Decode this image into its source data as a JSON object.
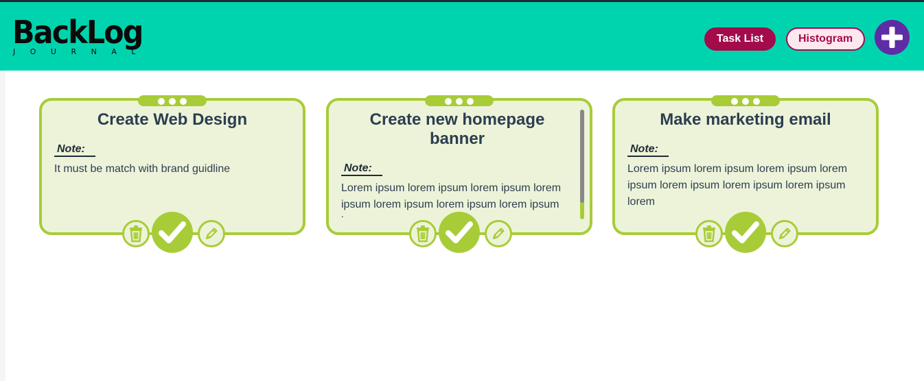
{
  "app": {
    "logo_title": "BackLog",
    "logo_subtitle": "JOURNAL"
  },
  "header": {
    "task_list_label": "Task List",
    "histogram_label": "Histogram",
    "add_icon": "plus-icon"
  },
  "colors": {
    "header_bg": "#00d4ae",
    "accent_primary": "#a30b4b",
    "add_button": "#5e2ca5",
    "card_border": "#a8cc38",
    "card_bg": "#edf3d9",
    "text": "#2c3e50"
  },
  "cards": [
    {
      "title": "Create Web Design",
      "note_label": "Note:",
      "note_text": "It must be match with brand guidline",
      "icons": [
        "trash-icon",
        "check-icon",
        "pencil-icon"
      ]
    },
    {
      "title": "Create new homepage banner",
      "note_label": "Note:",
      "note_text": "Lorem ipsum lorem ipsum lorem ipsum lorem ipsum lorem ipsum lorem ipsum lorem ipsum lorem",
      "icons": [
        "trash-icon",
        "check-icon",
        "pencil-icon"
      ]
    },
    {
      "title": "Make marketing email",
      "note_label": "Note:",
      "note_text": "Lorem ipsum lorem ipsum lorem ipsum lorem ipsum lorem ipsum lorem ipsum lorem ipsum lorem",
      "icons": [
        "trash-icon",
        "check-icon",
        "pencil-icon"
      ]
    }
  ]
}
